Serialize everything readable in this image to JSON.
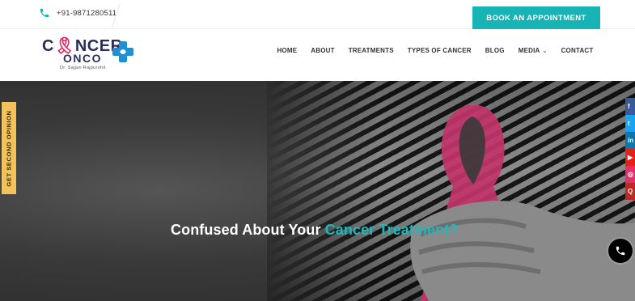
{
  "topbar": {
    "phone": "+91-9871280511",
    "appointment_button": "BOOK AN APPOINTMENT"
  },
  "logo": {
    "word_c": "C",
    "word_ncer": "NCER",
    "onco": "ONCO",
    "doctor": "Dr. Sajjan Rajpurohit"
  },
  "nav": {
    "items": [
      "HOME",
      "ABOUT",
      "TREATMENTS",
      "TYPES OF CANCER",
      "BLOG",
      "MEDIA",
      "CONTACT"
    ]
  },
  "hero": {
    "heading_main": "Confused About Your ",
    "heading_accent": "Cancer Treatment?"
  },
  "side_tab": {
    "label": "GET SECOND OPINION"
  },
  "social": [
    {
      "icon": "facebook-icon",
      "glyph": "f",
      "color": "#3b5998"
    },
    {
      "icon": "twitter-icon",
      "glyph": "t",
      "color": "#1da1f2"
    },
    {
      "icon": "linkedin-icon",
      "glyph": "in",
      "color": "#0e76a8"
    },
    {
      "icon": "youtube-icon",
      "glyph": "▶",
      "color": "#e62117"
    },
    {
      "icon": "instagram-icon",
      "glyph": "◎",
      "color": "#e1306c"
    },
    {
      "icon": "quora-icon",
      "glyph": "Q",
      "color": "#b92b27"
    }
  ],
  "colors": {
    "accent": "#17b3b5",
    "side_tab": "#f1c35a",
    "ribbon": "#e0245e"
  }
}
